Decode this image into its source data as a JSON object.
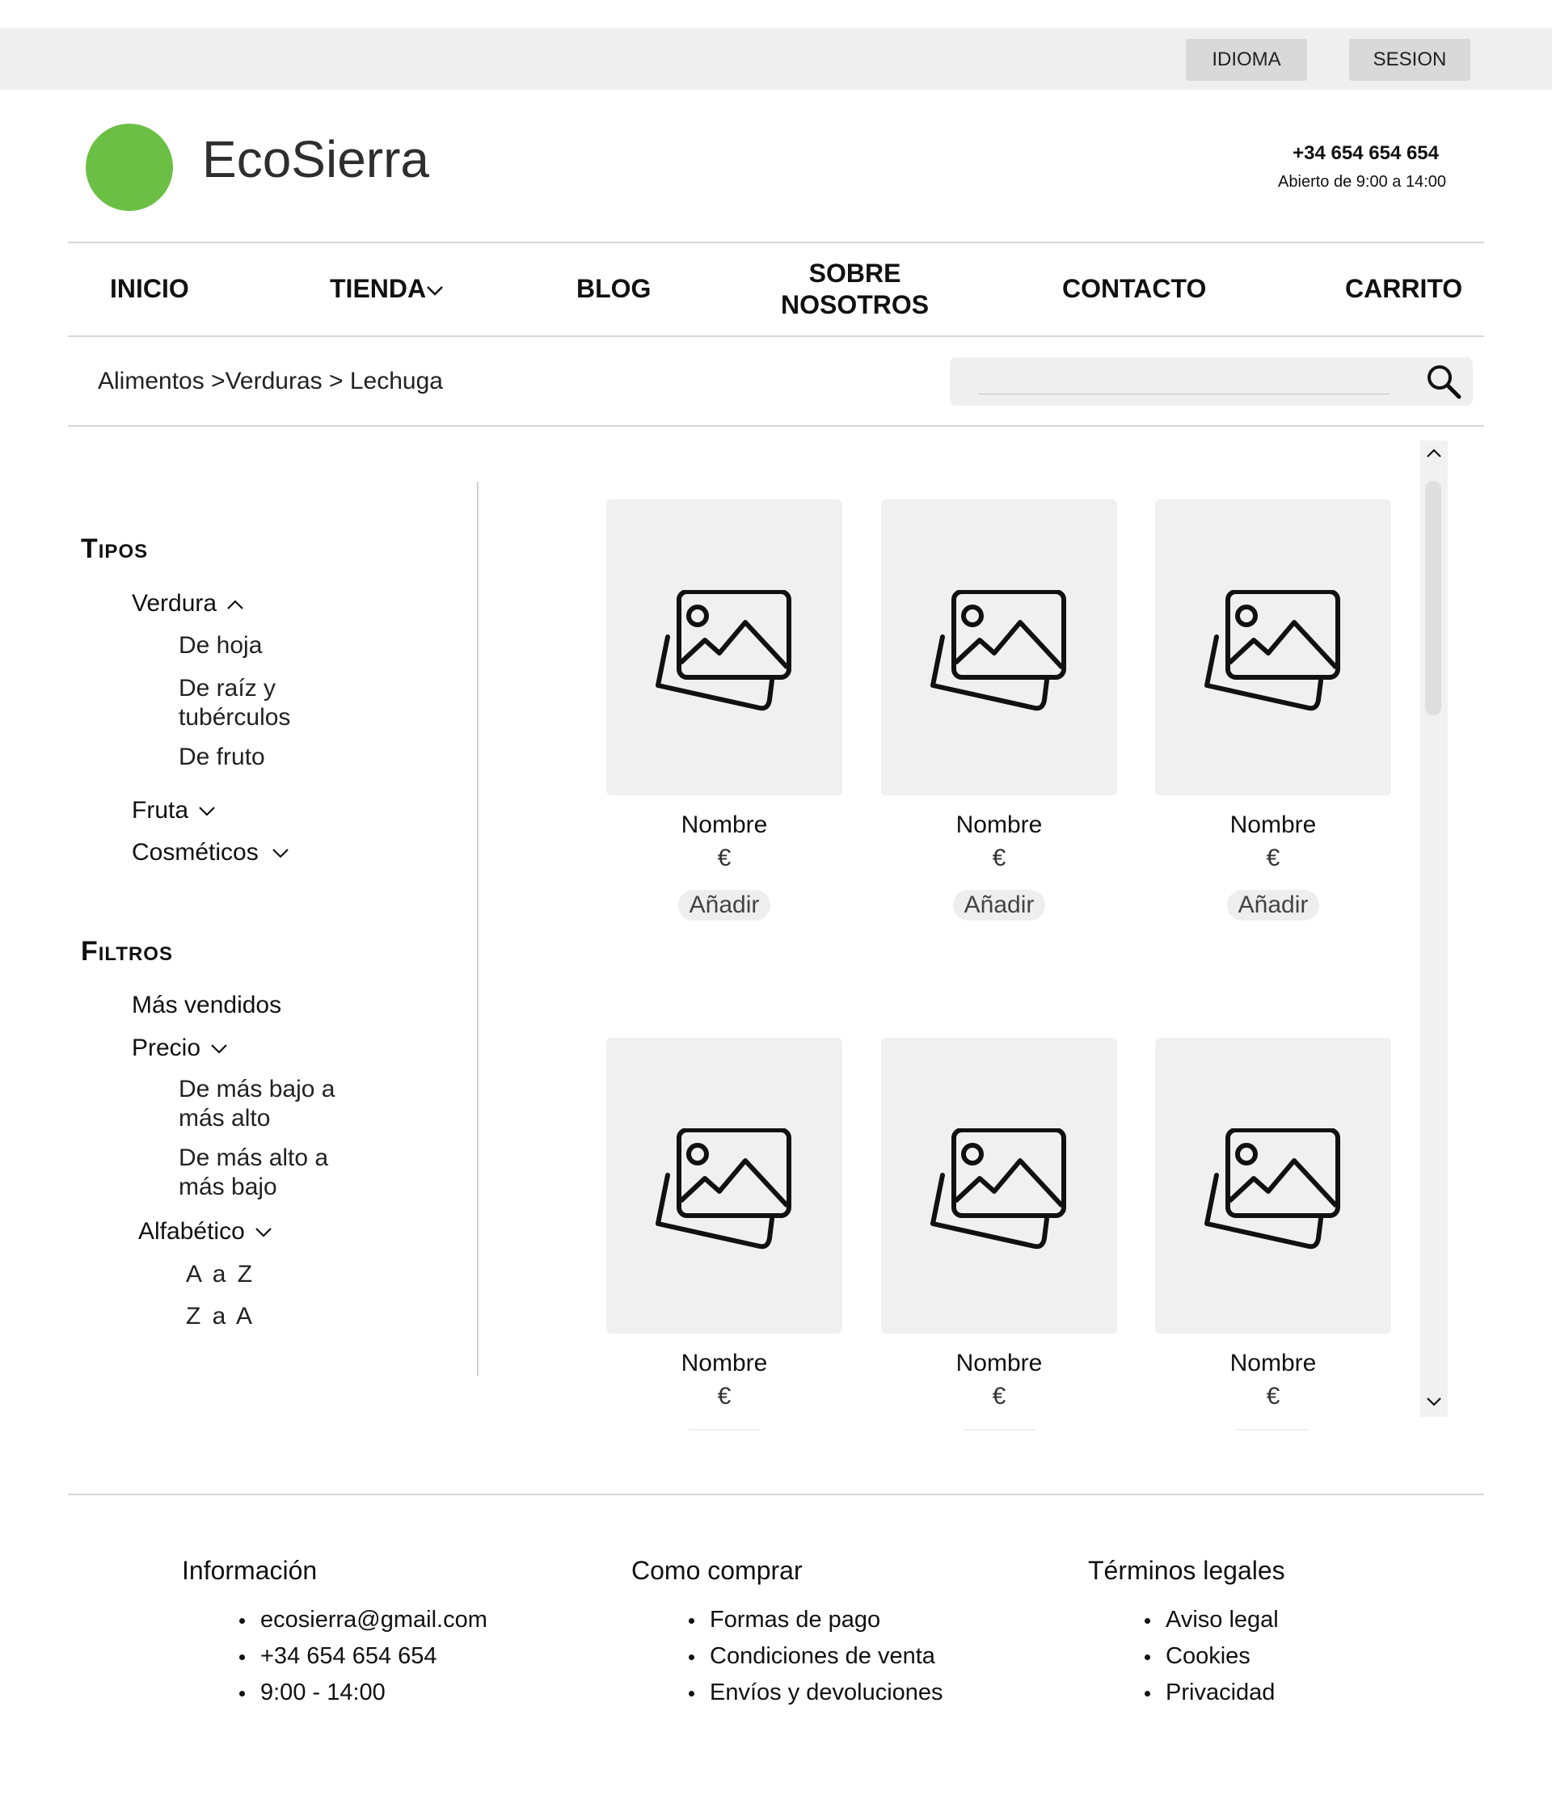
{
  "topbar": {
    "language_label": "IDIOMA",
    "session_label": "SESION"
  },
  "header": {
    "brand_name": "EcoSierra",
    "brand_color": "#6cbf45",
    "phone": "+34 654 654 654",
    "hours": "Abierto de 9:00 a 14:00"
  },
  "nav": {
    "inicio": "INICIO",
    "tienda": "TIENDA",
    "blog": "BLOG",
    "sobre_line1": "SOBRE",
    "sobre_line2": "NOSOTROS",
    "contacto": "CONTACTO",
    "carrito": "CARRITO"
  },
  "breadcrumb": "Alimentos >Verduras > Lechuga",
  "search": {
    "value": "",
    "icon": "search-icon"
  },
  "sidebar": {
    "tipos_heading": "Tipos",
    "verdura": "Verdura",
    "verdura_subs": [
      "De hoja",
      "De raíz y tubérculos",
      "De fruto"
    ],
    "fruta": "Fruta",
    "cosmeticos": "Cosméticos",
    "filtros_heading": "Filtros",
    "mas_vendidos": "Más vendidos",
    "precio": "Precio",
    "precio_subs": [
      "De más bajo a más alto",
      "De más alto a más bajo"
    ],
    "alfabetico": "Alfabético",
    "alfabetico_subs": [
      "A a Z",
      "Z a A"
    ]
  },
  "products": [
    {
      "name": "Nombre",
      "price": "€",
      "add_label": "Añadir",
      "image_icon": "image-placeholder-icon"
    },
    {
      "name": "Nombre",
      "price": "€",
      "add_label": "Añadir",
      "image_icon": "image-placeholder-icon"
    },
    {
      "name": "Nombre",
      "price": "€",
      "add_label": "Añadir",
      "image_icon": "image-placeholder-icon"
    },
    {
      "name": "Nombre",
      "price": "€",
      "image_icon": "image-placeholder-icon"
    },
    {
      "name": "Nombre",
      "price": "€",
      "image_icon": "image-placeholder-icon"
    },
    {
      "name": "Nombre",
      "price": "€",
      "image_icon": "image-placeholder-icon"
    }
  ],
  "footer": {
    "info_title": "Información",
    "info_items": [
      "ecosierra@gmail.com",
      "+34 654 654 654",
      "9:00 - 14:00"
    ],
    "comprar_title": "Como comprar",
    "comprar_items": [
      "Formas de pago",
      "Condiciones de venta",
      "Envíos y devoluciones"
    ],
    "legal_title": "Términos legales",
    "legal_items": [
      "Aviso legal",
      "Cookies",
      "Privacidad"
    ]
  }
}
